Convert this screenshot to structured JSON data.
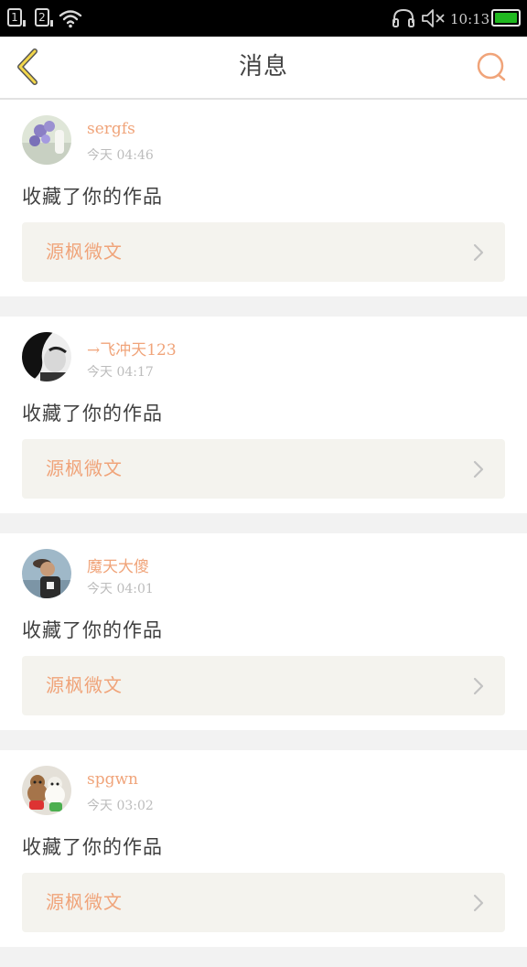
{
  "status_bar": {
    "sim1": "1",
    "sim2": "2",
    "time": "10:13",
    "battery_color": "#1fb81f"
  },
  "header": {
    "title": "消息",
    "back_icon": "chevron-left-icon",
    "search_icon": "search-icon",
    "accent_color": "#f0a47a"
  },
  "messages": [
    {
      "username": "sergfs",
      "time": "今天 04:46",
      "action": "收藏了你的作品",
      "work_title": "源枫微文"
    },
    {
      "username": "→飞冲天123",
      "time": "今天 04:17",
      "action": "收藏了你的作品",
      "work_title": "源枫微文"
    },
    {
      "username": "魔天大傻",
      "time": "今天 04:01",
      "action": "收藏了你的作品",
      "work_title": "源枫微文"
    },
    {
      "username": "spgwn",
      "time": "今天 03:02",
      "action": "收藏了你的作品",
      "work_title": "源枫微文"
    }
  ]
}
